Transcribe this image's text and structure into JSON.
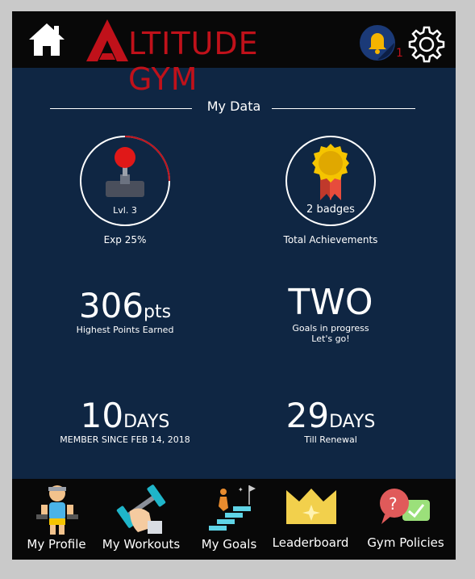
{
  "header": {
    "logo_text": "LTITUDE GYM",
    "notification_count": "1"
  },
  "section": {
    "title": "My Data"
  },
  "stats": {
    "level": {
      "label": "Lvl. 3",
      "caption": "Exp 25%",
      "progress": 0.25,
      "accent": "#c0111a"
    },
    "achievements": {
      "label": "2 badges",
      "caption": "Total Achievements"
    },
    "points": {
      "value": "306",
      "unit": "pts",
      "caption": "Highest Points Earned"
    },
    "goals": {
      "value": "TWO",
      "line1": "Goals in progress",
      "line2": "Let's go!"
    },
    "member": {
      "value": "10",
      "unit": "DAYS",
      "caption": "MEMBER SINCE FEB 14, 2018"
    },
    "renewal": {
      "value": "29",
      "unit": "DAYS",
      "caption": "Till Renewal"
    }
  },
  "nav": {
    "items": [
      {
        "label": "My Profile",
        "icon": "profile-icon"
      },
      {
        "label": "My Workouts",
        "icon": "dumbbell-icon"
      },
      {
        "label": "My Goals",
        "icon": "goals-stairs-icon"
      },
      {
        "label": "Leaderboard",
        "icon": "crown-icon"
      },
      {
        "label": "Gym Policies",
        "icon": "policies-chat-icon"
      }
    ]
  },
  "colors": {
    "background": "#0f2643",
    "header": "#080808",
    "brand_red": "#c0111a"
  }
}
